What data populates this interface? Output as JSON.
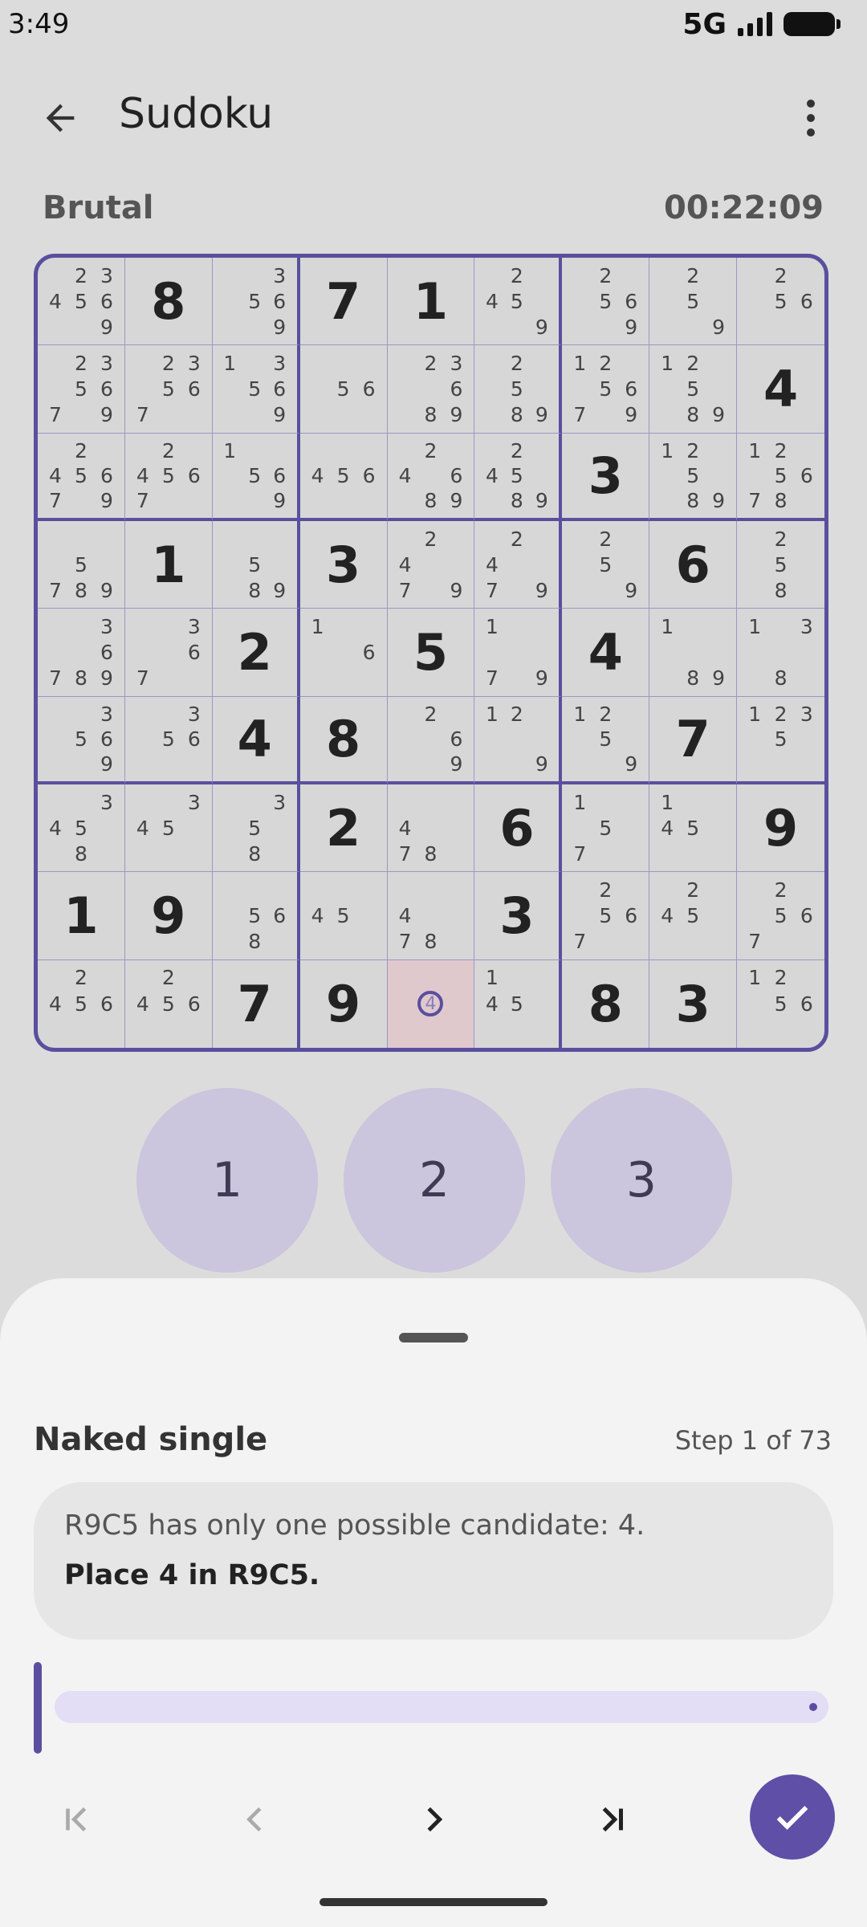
{
  "status_bar": {
    "time": "3:49",
    "network": "5G"
  },
  "app_bar": {
    "title": "Sudoku"
  },
  "game": {
    "difficulty": "Brutal",
    "timer": "00:22:09"
  },
  "grid": [
    [
      {
        "c": [
          2,
          3,
          4,
          5,
          6,
          9
        ]
      },
      {
        "v": 8
      },
      {
        "c": [
          3,
          5,
          6,
          9
        ]
      },
      {
        "v": 7
      },
      {
        "v": 1
      },
      {
        "c": [
          2,
          4,
          5,
          9
        ]
      },
      {
        "c": [
          2,
          5,
          6,
          9
        ]
      },
      {
        "c": [
          2,
          5,
          9
        ]
      },
      {
        "c": [
          2,
          5,
          6
        ]
      }
    ],
    [
      {
        "c": [
          2,
          3,
          5,
          6,
          7,
          9
        ]
      },
      {
        "c": [
          2,
          3,
          5,
          6,
          7
        ]
      },
      {
        "c": [
          1,
          3,
          5,
          6,
          9
        ]
      },
      {
        "c": [
          5,
          6
        ]
      },
      {
        "c": [
          2,
          3,
          6,
          8,
          9
        ]
      },
      {
        "c": [
          2,
          5,
          8,
          9
        ]
      },
      {
        "c": [
          1,
          2,
          5,
          6,
          7,
          9
        ]
      },
      {
        "c": [
          1,
          2,
          5,
          8,
          9
        ]
      },
      {
        "v": 4
      }
    ],
    [
      {
        "c": [
          2,
          4,
          5,
          6,
          7,
          9
        ]
      },
      {
        "c": [
          2,
          4,
          5,
          6,
          7
        ]
      },
      {
        "c": [
          1,
          5,
          6,
          9
        ]
      },
      {
        "c": [
          4,
          5,
          6
        ]
      },
      {
        "c": [
          2,
          4,
          6,
          8,
          9
        ]
      },
      {
        "c": [
          2,
          4,
          5,
          8,
          9
        ]
      },
      {
        "v": 3
      },
      {
        "c": [
          1,
          2,
          5,
          8,
          9
        ]
      },
      {
        "c": [
          1,
          2,
          5,
          6,
          7,
          8
        ]
      }
    ],
    [
      {
        "c": [
          5,
          7,
          8,
          9
        ]
      },
      {
        "v": 1
      },
      {
        "c": [
          5,
          8,
          9
        ]
      },
      {
        "v": 3
      },
      {
        "c": [
          2,
          4,
          7,
          9
        ]
      },
      {
        "c": [
          2,
          4,
          7,
          9
        ]
      },
      {
        "c": [
          2,
          5,
          9
        ]
      },
      {
        "v": 6
      },
      {
        "c": [
          2,
          5,
          8
        ]
      }
    ],
    [
      {
        "c": [
          3,
          6,
          7,
          8,
          9
        ]
      },
      {
        "c": [
          3,
          6,
          7
        ]
      },
      {
        "v": 2
      },
      {
        "c": [
          1,
          6
        ]
      },
      {
        "v": 5
      },
      {
        "c": [
          1,
          7,
          9
        ]
      },
      {
        "v": 4
      },
      {
        "c": [
          1,
          8,
          9
        ]
      },
      {
        "c": [
          1,
          3,
          8
        ]
      }
    ],
    [
      {
        "c": [
          3,
          5,
          6,
          9
        ]
      },
      {
        "c": [
          3,
          5,
          6
        ]
      },
      {
        "v": 4
      },
      {
        "v": 8
      },
      {
        "c": [
          2,
          6,
          9
        ]
      },
      {
        "c": [
          1,
          2,
          9
        ]
      },
      {
        "c": [
          1,
          2,
          5,
          9
        ]
      },
      {
        "v": 7
      },
      {
        "c": [
          1,
          2,
          3,
          5
        ]
      }
    ],
    [
      {
        "c": [
          3,
          4,
          5,
          8
        ]
      },
      {
        "c": [
          3,
          4,
          5
        ]
      },
      {
        "c": [
          3,
          5,
          8
        ]
      },
      {
        "v": 2
      },
      {
        "c": [
          4,
          7,
          8
        ]
      },
      {
        "v": 6
      },
      {
        "c": [
          1,
          5,
          7
        ]
      },
      {
        "c": [
          1,
          4,
          5
        ]
      },
      {
        "v": 9
      }
    ],
    [
      {
        "v": 1
      },
      {
        "v": 9
      },
      {
        "c": [
          5,
          6,
          8
        ]
      },
      {
        "c": [
          4,
          5
        ]
      },
      {
        "c": [
          4,
          7,
          8
        ]
      },
      {
        "v": 3
      },
      {
        "c": [
          2,
          5,
          6,
          7
        ]
      },
      {
        "c": [
          2,
          4,
          5
        ]
      },
      {
        "c": [
          2,
          5,
          6,
          7
        ]
      }
    ],
    [
      {
        "c": [
          2,
          4,
          5,
          6
        ]
      },
      {
        "c": [
          2,
          4,
          5,
          6
        ]
      },
      {
        "v": 7
      },
      {
        "v": 9
      },
      {
        "h": "4",
        "sel": true
      },
      {
        "c": [
          1,
          4,
          5
        ]
      },
      {
        "v": 8
      },
      {
        "v": 3
      },
      {
        "c": [
          1,
          2,
          5,
          6
        ]
      }
    ]
  ],
  "numpad": [
    "1",
    "2",
    "3"
  ],
  "hint": {
    "technique": "Naked single",
    "step": "Step 1 of 73",
    "explanation": "R9C5 has only one possible candidate: 4.",
    "action": "Place 4 in R9C5."
  },
  "colors": {
    "accent": "#5a4f9e",
    "selected_cell": "#dfc9cd",
    "numpad": "#cbc5dd"
  }
}
